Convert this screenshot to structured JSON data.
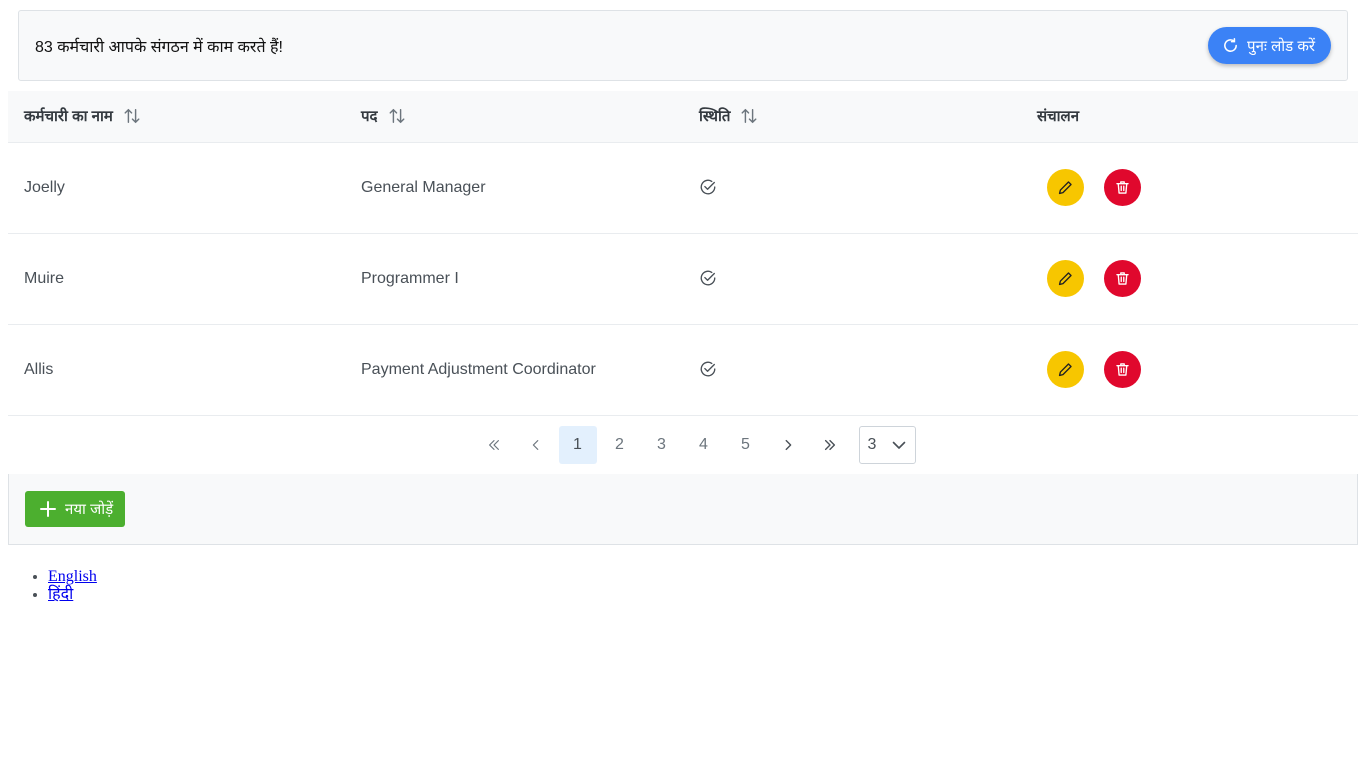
{
  "header": {
    "summary_text": "83 कर्मचारी आपके संगठन में काम करते हैं!",
    "reload_label": "पुनः लोड करें"
  },
  "table": {
    "columns": [
      {
        "label": "कर्मचारी का नाम",
        "sortable": true
      },
      {
        "label": "पद",
        "sortable": true
      },
      {
        "label": "स्थिति",
        "sortable": true
      },
      {
        "label": "संचालन",
        "sortable": false
      }
    ],
    "rows": [
      {
        "name": "Joelly",
        "position": "General Manager",
        "status": "check-circle-icon"
      },
      {
        "name": "Muire",
        "position": "Programmer I",
        "status": "check-circle-icon"
      },
      {
        "name": "Allis",
        "position": "Payment Adjustment Coordinator",
        "status": "check-circle-icon"
      }
    ]
  },
  "pagination": {
    "pages": [
      "1",
      "2",
      "3",
      "4",
      "5"
    ],
    "current_page": "1",
    "rows_per_page": "3"
  },
  "footer": {
    "add_label": "नया जोड़ें"
  },
  "languages": [
    {
      "label": "English"
    },
    {
      "label": "हिंदी"
    }
  ],
  "colors": {
    "reload_button": "#3b82f6",
    "edit_button": "#f7c600",
    "delete_button": "#e0082d",
    "add_button": "#4caf2f",
    "active_page": "#e3f0fd"
  }
}
